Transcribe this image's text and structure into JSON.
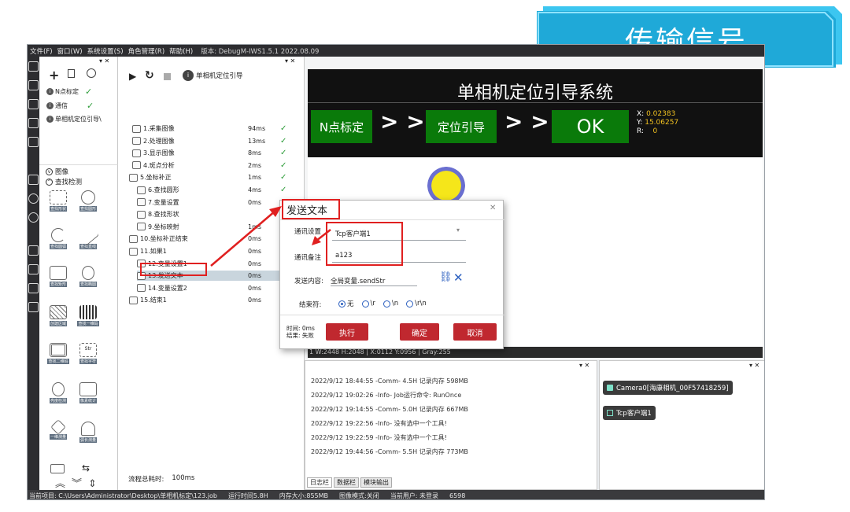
{
  "menubar": {
    "items": [
      "文件(F)",
      "窗口(W)",
      "系统设置(S)",
      "角色管理(R)",
      "帮助(H)"
    ],
    "version": "版本: DebugM-IWS1.5.1 2022.08.09"
  },
  "banner": {
    "title": "传输信号"
  },
  "project": {
    "close": "▾ ✕",
    "items": [
      "N点标定",
      "通信",
      "单相机定位引导\\"
    ]
  },
  "toolbox": {
    "sections": [
      "图像",
      "查找检测"
    ],
    "items": [
      "查找形状",
      "查找圆形",
      "查找圆弧",
      "查找直线",
      "查找矩形",
      "查找椭圆",
      "创建区域",
      "查找一维码",
      "查找二维码",
      "查找字符",
      "亮度检测",
      "像素统计",
      "一维测量",
      "弧长测量"
    ]
  },
  "flow": {
    "close": "▾ ✕",
    "header": "单相机定位引导",
    "footer": "流程总耗时:",
    "footer_value": "100ms",
    "nodes": [
      {
        "label": "1.采集图像",
        "time": "94ms",
        "check": "✓"
      },
      {
        "label": "2.处理图像",
        "time": "13ms",
        "check": "✓"
      },
      {
        "label": "3.显示图像",
        "time": "8ms",
        "check": "✓"
      },
      {
        "label": "4.斑点分析",
        "time": "2ms",
        "check": "✓"
      },
      {
        "label": "5.坐标补正",
        "time": "1ms",
        "check": "✓"
      },
      {
        "label": "6.查找圆形",
        "time": "4ms",
        "check": "✓"
      },
      {
        "label": "7.变量设置",
        "time": "0ms",
        "check": "✓"
      },
      {
        "label": "8.查找形状",
        "time": "",
        "check": ""
      },
      {
        "label": "9.坐标映射",
        "time": "1ms",
        "check": ""
      },
      {
        "label": "10.坐标补正结束",
        "time": "0ms",
        "check": ""
      },
      {
        "label": "11.如果1",
        "time": "0ms",
        "check": ""
      },
      {
        "label": "12.变量设置1",
        "time": "0ms",
        "check": ""
      },
      {
        "label": "13.发送文本",
        "time": "0ms",
        "check": ""
      },
      {
        "label": "14.变量设置2",
        "time": "0ms",
        "check": ""
      },
      {
        "label": "15.结束1",
        "time": "0ms",
        "check": ""
      }
    ]
  },
  "display": {
    "title": "单相机定位引导系统",
    "steps": [
      "N点标定",
      "定位引导",
      "OK"
    ],
    "arrows": "> >",
    "coords": {
      "x_label": "X:",
      "x": "0.02383",
      "y_label": "Y:",
      "y": "15.06257",
      "r_label": "R:",
      "r": "0"
    },
    "info": "1 W:2448 H:2048 | X:0112 Y:0956 | Gray:255"
  },
  "dialog": {
    "title": "发送文本",
    "close": "✕",
    "comm_label": "通讯设置",
    "comm_value": "Tcp客户端1",
    "note_label": "通讯备注",
    "note_value": "a123",
    "content_label": "发送内容:",
    "content_value": "全局变量.sendStr",
    "end_label": "结束符:",
    "end_options": [
      "无",
      "\\r",
      "\\n",
      "\\r\\n"
    ],
    "time_label": "时间: 0ms",
    "result_label": "结果: 失败",
    "btn_run": "执行",
    "btn_ok": "确定",
    "btn_cancel": "取消"
  },
  "log": {
    "close": "▾ ✕",
    "lines": [
      "2022/9/12 18:44:55 -Comm- 4.5H 记录内存 598MB",
      "2022/9/12 19:02:26 -Info- Job运行命令: RunOnce",
      "2022/9/12 19:14:55 -Comm- 5.0H 记录内存 667MB",
      "2022/9/12 19:22:56 -Info- 没有选中一个工具!",
      "2022/9/12 19:22:59 -Info- 没有选中一个工具!",
      "2022/9/12 19:44:56 -Comm- 5.5H 记录内存 773MB"
    ],
    "tabs": [
      "日志栏",
      "数据栏",
      "模块输出"
    ]
  },
  "devices": {
    "close": "▾ ✕",
    "items": [
      "Camera0[海康相机_00F57418259]",
      "Tcp客户端1"
    ]
  },
  "status": {
    "project": "当前项目: C:\\Users\\Administrator\\Desktop\\单相机标定\\123.job",
    "runtime": "运行时间5.8H",
    "memory": "内存大小:855MB",
    "image_mode": "图像模式:关闭",
    "user_label": "当前用户:",
    "user": "未登录",
    "num": "6598"
  },
  "colors": {
    "accent": "#c0282f",
    "display_dark": "#111111",
    "step_green": "#0a7a0a",
    "banner_blue": "#29b6e6"
  }
}
